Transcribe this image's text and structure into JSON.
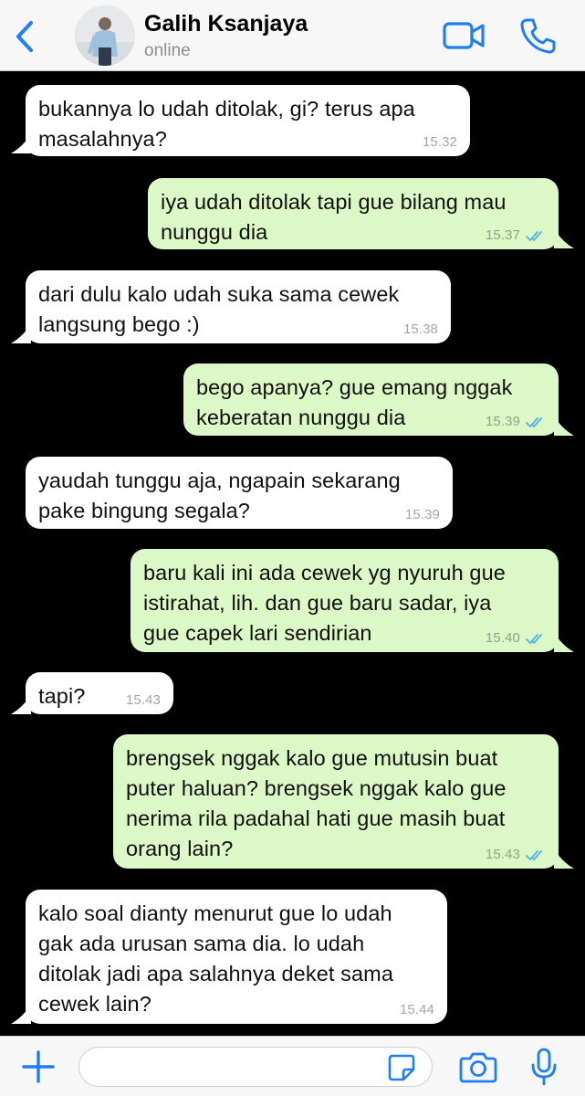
{
  "header": {
    "contact_name": "Galih Ksanjaya",
    "status": "online",
    "back_icon": "chevron-left-icon",
    "video_icon": "video-camera-icon",
    "call_icon": "phone-icon"
  },
  "messages": [
    {
      "direction": "in",
      "text": "bukannya lo udah ditolak, gi? terus apa\nmasalahnya?",
      "time": "15.32"
    },
    {
      "direction": "out",
      "text": "iya udah ditolak tapi gue bilang mau\nnunggu dia",
      "time": "15.37",
      "status": "read"
    },
    {
      "direction": "in",
      "text": "dari dulu kalo udah suka sama cewek\nlangsung bego :)",
      "time": "15.38"
    },
    {
      "direction": "out",
      "text": "bego apanya? gue emang nggak\nkeberatan nunggu dia",
      "time": "15.39",
      "status": "read"
    },
    {
      "direction": "in",
      "text": "yaudah tunggu aja, ngapain sekarang\npake bingung segala?",
      "time": "15.39"
    },
    {
      "direction": "out",
      "text": "baru kali ini ada cewek yg nyuruh gue\nistirahat, lih. dan gue baru sadar, iya\ngue capek lari sendirian",
      "time": "15.40",
      "status": "read"
    },
    {
      "direction": "in",
      "text": "tapi?",
      "time": "15.43"
    },
    {
      "direction": "out",
      "text": "brengsek nggak kalo gue mutusin buat\nputer haluan? brengsek nggak kalo gue\nnerima rila padahal hati gue masih buat\norang lain?",
      "time": "15.43",
      "status": "read"
    },
    {
      "direction": "in",
      "text": "kalo soal dianty menurut gue lo udah\ngak ada urusan sama dia. lo udah\nditolak jadi apa salahnya deket sama\ncewek lain?",
      "time": "15.44"
    }
  ],
  "input_bar": {
    "placeholder": "",
    "value": "",
    "plus_icon": "plus-icon",
    "sticker_icon": "sticker-icon",
    "camera_icon": "camera-icon",
    "mic_icon": "microphone-icon"
  },
  "colors": {
    "accent": "#1f7ef6",
    "incoming_bubble": "#ffffff",
    "outgoing_bubble": "#dcf8c6",
    "read_ticks": "#4fb3e8",
    "chat_background": "#000000"
  }
}
